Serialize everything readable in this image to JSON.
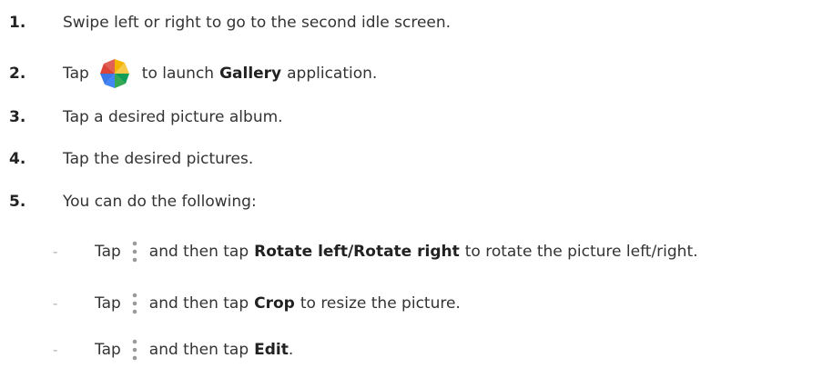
{
  "steps": [
    {
      "num": "1.",
      "text": "Swipe left or right to go to the second idle screen."
    },
    {
      "num": "2.",
      "pre": "Tap",
      "icon": "gallery-pinwheel-icon",
      "mid": "to launch",
      "bold": "Gallery",
      "post": "application."
    },
    {
      "num": "3.",
      "text": "Tap a desired picture album."
    },
    {
      "num": "4.",
      "text": "Tap the desired pictures."
    },
    {
      "num": "5.",
      "text": "You can do the following:"
    }
  ],
  "substeps": [
    {
      "dash": "-",
      "pre": "Tap",
      "icon": "more-options-icon",
      "mid": "and then tap",
      "bold1": "Rotate left",
      "sep": "/",
      "bold2": "Rotate right",
      "post": "to rotate the picture left/right."
    },
    {
      "dash": "-",
      "pre": "Tap",
      "icon": "more-options-icon",
      "mid": "and then tap",
      "bold": "Crop",
      "post": "to resize the picture."
    },
    {
      "dash": "-",
      "pre": "Tap",
      "icon": "more-options-icon",
      "mid": "and then tap",
      "bold": "Edit",
      "post": "."
    }
  ],
  "colors": {
    "text": "#333333",
    "dash": "#b0b0b0",
    "menu_dots": "#9a9a9a"
  }
}
